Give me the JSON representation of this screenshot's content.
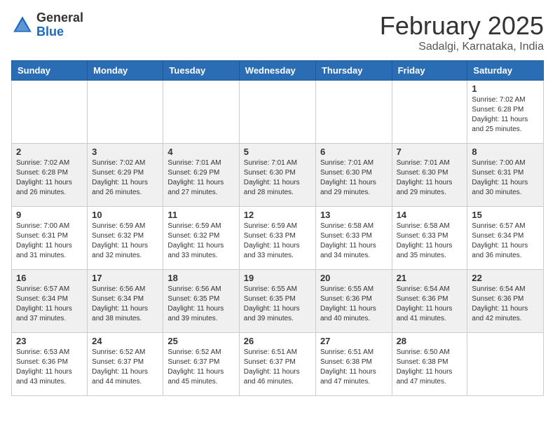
{
  "header": {
    "logo_general": "General",
    "logo_blue": "Blue",
    "month_year": "February 2025",
    "location": "Sadalgi, Karnataka, India"
  },
  "days_of_week": [
    "Sunday",
    "Monday",
    "Tuesday",
    "Wednesday",
    "Thursday",
    "Friday",
    "Saturday"
  ],
  "weeks": [
    [
      {
        "day": "",
        "content": ""
      },
      {
        "day": "",
        "content": ""
      },
      {
        "day": "",
        "content": ""
      },
      {
        "day": "",
        "content": ""
      },
      {
        "day": "",
        "content": ""
      },
      {
        "day": "",
        "content": ""
      },
      {
        "day": "1",
        "content": "Sunrise: 7:02 AM\nSunset: 6:28 PM\nDaylight: 11 hours and 25 minutes."
      }
    ],
    [
      {
        "day": "2",
        "content": "Sunrise: 7:02 AM\nSunset: 6:28 PM\nDaylight: 11 hours and 26 minutes."
      },
      {
        "day": "3",
        "content": "Sunrise: 7:02 AM\nSunset: 6:29 PM\nDaylight: 11 hours and 26 minutes."
      },
      {
        "day": "4",
        "content": "Sunrise: 7:01 AM\nSunset: 6:29 PM\nDaylight: 11 hours and 27 minutes."
      },
      {
        "day": "5",
        "content": "Sunrise: 7:01 AM\nSunset: 6:30 PM\nDaylight: 11 hours and 28 minutes."
      },
      {
        "day": "6",
        "content": "Sunrise: 7:01 AM\nSunset: 6:30 PM\nDaylight: 11 hours and 29 minutes."
      },
      {
        "day": "7",
        "content": "Sunrise: 7:01 AM\nSunset: 6:30 PM\nDaylight: 11 hours and 29 minutes."
      },
      {
        "day": "8",
        "content": "Sunrise: 7:00 AM\nSunset: 6:31 PM\nDaylight: 11 hours and 30 minutes."
      }
    ],
    [
      {
        "day": "9",
        "content": "Sunrise: 7:00 AM\nSunset: 6:31 PM\nDaylight: 11 hours and 31 minutes."
      },
      {
        "day": "10",
        "content": "Sunrise: 6:59 AM\nSunset: 6:32 PM\nDaylight: 11 hours and 32 minutes."
      },
      {
        "day": "11",
        "content": "Sunrise: 6:59 AM\nSunset: 6:32 PM\nDaylight: 11 hours and 33 minutes."
      },
      {
        "day": "12",
        "content": "Sunrise: 6:59 AM\nSunset: 6:33 PM\nDaylight: 11 hours and 33 minutes."
      },
      {
        "day": "13",
        "content": "Sunrise: 6:58 AM\nSunset: 6:33 PM\nDaylight: 11 hours and 34 minutes."
      },
      {
        "day": "14",
        "content": "Sunrise: 6:58 AM\nSunset: 6:33 PM\nDaylight: 11 hours and 35 minutes."
      },
      {
        "day": "15",
        "content": "Sunrise: 6:57 AM\nSunset: 6:34 PM\nDaylight: 11 hours and 36 minutes."
      }
    ],
    [
      {
        "day": "16",
        "content": "Sunrise: 6:57 AM\nSunset: 6:34 PM\nDaylight: 11 hours and 37 minutes."
      },
      {
        "day": "17",
        "content": "Sunrise: 6:56 AM\nSunset: 6:34 PM\nDaylight: 11 hours and 38 minutes."
      },
      {
        "day": "18",
        "content": "Sunrise: 6:56 AM\nSunset: 6:35 PM\nDaylight: 11 hours and 39 minutes."
      },
      {
        "day": "19",
        "content": "Sunrise: 6:55 AM\nSunset: 6:35 PM\nDaylight: 11 hours and 39 minutes."
      },
      {
        "day": "20",
        "content": "Sunrise: 6:55 AM\nSunset: 6:36 PM\nDaylight: 11 hours and 40 minutes."
      },
      {
        "day": "21",
        "content": "Sunrise: 6:54 AM\nSunset: 6:36 PM\nDaylight: 11 hours and 41 minutes."
      },
      {
        "day": "22",
        "content": "Sunrise: 6:54 AM\nSunset: 6:36 PM\nDaylight: 11 hours and 42 minutes."
      }
    ],
    [
      {
        "day": "23",
        "content": "Sunrise: 6:53 AM\nSunset: 6:36 PM\nDaylight: 11 hours and 43 minutes."
      },
      {
        "day": "24",
        "content": "Sunrise: 6:52 AM\nSunset: 6:37 PM\nDaylight: 11 hours and 44 minutes."
      },
      {
        "day": "25",
        "content": "Sunrise: 6:52 AM\nSunset: 6:37 PM\nDaylight: 11 hours and 45 minutes."
      },
      {
        "day": "26",
        "content": "Sunrise: 6:51 AM\nSunset: 6:37 PM\nDaylight: 11 hours and 46 minutes."
      },
      {
        "day": "27",
        "content": "Sunrise: 6:51 AM\nSunset: 6:38 PM\nDaylight: 11 hours and 47 minutes."
      },
      {
        "day": "28",
        "content": "Sunrise: 6:50 AM\nSunset: 6:38 PM\nDaylight: 11 hours and 47 minutes."
      },
      {
        "day": "",
        "content": ""
      }
    ]
  ]
}
